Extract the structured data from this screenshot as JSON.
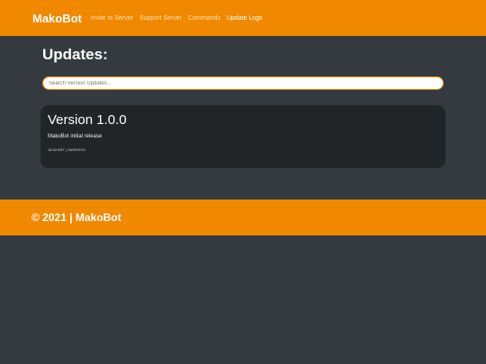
{
  "navbar": {
    "brand": "MakoBot",
    "links": [
      {
        "label": "Invite to Server"
      },
      {
        "label": "Support Server"
      },
      {
        "label": "Commands"
      },
      {
        "label": "Update Logs"
      }
    ],
    "active": "Update Logs"
  },
  "main": {
    "title": "Updates:",
    "search": {
      "placeholder": "Search Version Updates...",
      "value": ""
    },
    "updates": [
      {
        "version": "Version 1.0.0",
        "description": "MakoBot initial release",
        "meta": "18:33 BST | 28/09/2021"
      }
    ]
  },
  "footer": {
    "text": "© 2021 | MakoBot"
  },
  "colors": {
    "accent": "#f08800",
    "background": "#343a40",
    "card": "#222528"
  }
}
